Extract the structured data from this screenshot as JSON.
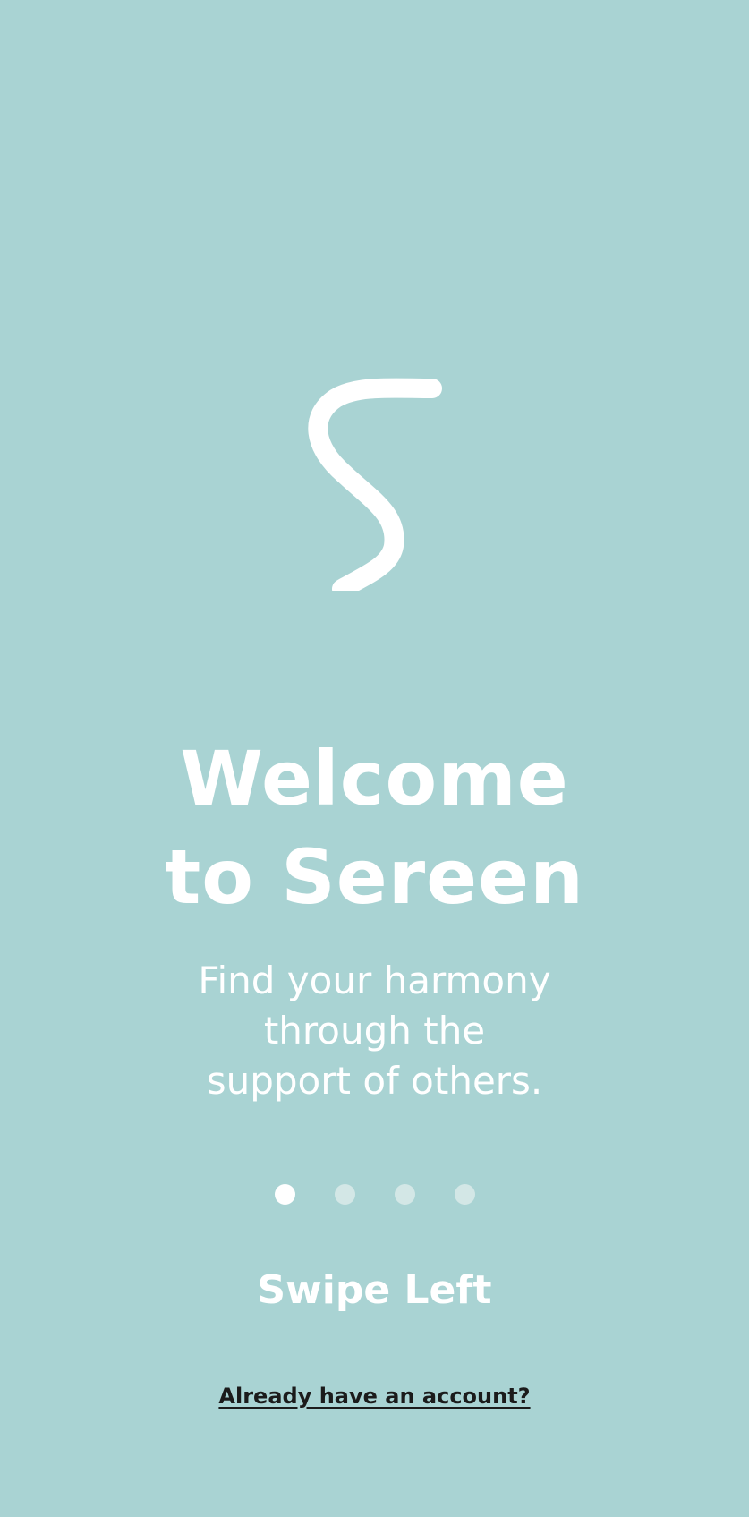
{
  "theme": {
    "background": "#a9d3d3",
    "text": "#ffffff",
    "dot_inactive": "#d3e7e6",
    "link": "#1b1b1b"
  },
  "logo": {
    "icon": "sereen-s-logo-icon"
  },
  "welcome": {
    "title_line1": "Welcome",
    "title_line2": "to Sereen",
    "subtitle_line1": "Find your harmony",
    "subtitle_line2": "through the",
    "subtitle_line3": "support of others."
  },
  "pagination": {
    "total": 4,
    "active_index": 0
  },
  "swipe_label": "Swipe Left",
  "account_link_label": "Already have an account?"
}
